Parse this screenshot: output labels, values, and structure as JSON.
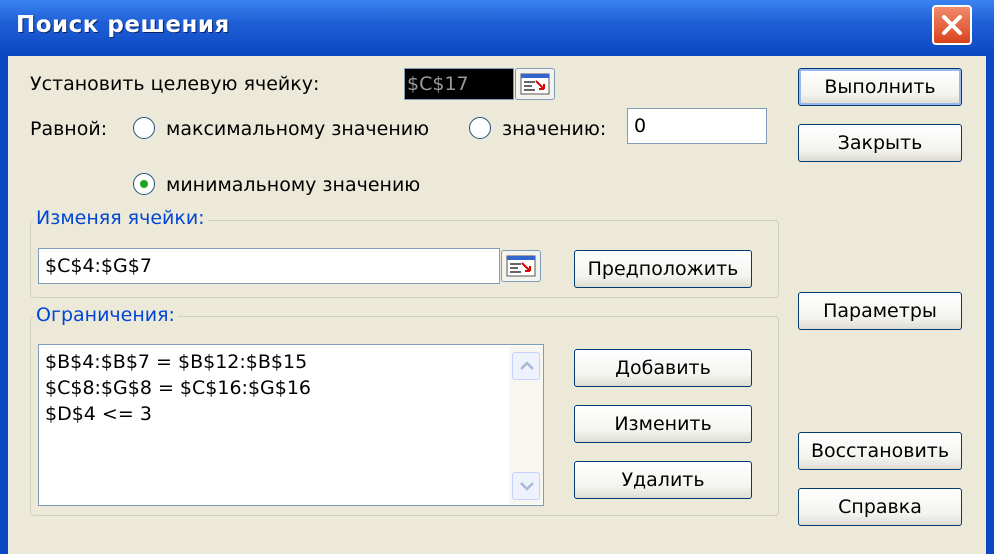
{
  "window": {
    "title": "Поиск решения"
  },
  "target": {
    "label": "Установить целевую ячейку:",
    "value": "$C$17"
  },
  "equal": {
    "label": "Равной:",
    "max_label": "максимальному значению",
    "value_label": "значению:",
    "value_input": "0",
    "min_label": "минимальному значению",
    "selected": "min"
  },
  "changing": {
    "group_title": "Изменяя ячейки:",
    "value": "$C$4:$G$7",
    "guess_button": "Предположить"
  },
  "constraints": {
    "group_title": "Ограничения:",
    "items": [
      "$B$4:$B$7 = $B$12:$B$15",
      "$C$8:$G$8 = $C$16:$G$16",
      "$D$4 <= 3"
    ],
    "add_button": "Добавить",
    "change_button": "Изменить",
    "delete_button": "Удалить"
  },
  "side_buttons": {
    "solve": "Выполнить",
    "close": "Закрыть",
    "options": "Параметры",
    "reset": "Восстановить",
    "help": "Справка"
  },
  "colors": {
    "titlebar": "#0a47c2",
    "dialog_bg": "#ece9d8",
    "group_title": "#0046d5",
    "radio_dot": "#21a121",
    "close_button": "#d9431d"
  },
  "icons": {
    "close": "close-x-icon",
    "ref": "collapse-dialog-icon",
    "scroll_up": "chevron-up-icon",
    "scroll_down": "chevron-down-icon"
  }
}
